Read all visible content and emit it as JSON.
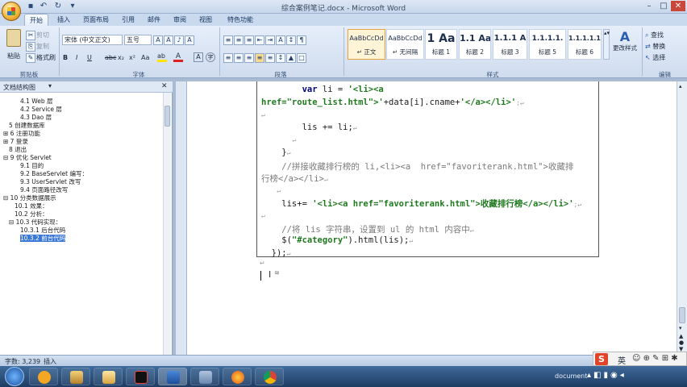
{
  "window": {
    "title": "综合案例笔记.docx - Microsoft Word"
  },
  "tabs": [
    "开始",
    "插入",
    "页面布局",
    "引用",
    "邮件",
    "审阅",
    "视图",
    "特色功能"
  ],
  "clipboard": {
    "paste": "粘贴",
    "cut": "剪切",
    "copy": "复制",
    "format_painter": "格式刷",
    "label": "剪贴板"
  },
  "font": {
    "name": "宋体 (中文正文)",
    "size": "五号",
    "bold": "B",
    "italic": "I",
    "underline": "U",
    "strike": "abc",
    "sub": "x₂",
    "sup": "x²",
    "case": "Aa",
    "label": "字体"
  },
  "paragraph": {
    "label": "段落"
  },
  "styles": {
    "items": [
      {
        "sample": "AaBbCcDd",
        "name": "↵ 正文"
      },
      {
        "sample": "AaBbCcDd",
        "name": "↵ 无间隔"
      },
      {
        "sample": "1 Aa",
        "name": "标题 1"
      },
      {
        "sample": "1.1 Aa",
        "name": "标题 2"
      },
      {
        "sample": "1.1.1 A",
        "name": "标题 3"
      },
      {
        "sample": "1.1.1.1.",
        "name": "标题 5"
      },
      {
        "sample": "1.1.1.1.1",
        "name": "标题 6"
      }
    ],
    "change": "更改样式",
    "label": "样式"
  },
  "editing": {
    "find": "查找",
    "replace": "替换",
    "select": "选择",
    "label": "编辑"
  },
  "left_pane": {
    "title": "文档结构图",
    "items": [
      {
        "text": "4.1 Web 层",
        "indent": 3
      },
      {
        "text": "4.2 Service 层",
        "indent": 3
      },
      {
        "text": "4.3 Dao 层",
        "indent": 3
      },
      {
        "text": "5 创建数据库",
        "indent": 1
      },
      {
        "text": "⊞ 6 注册功能",
        "indent": 0
      },
      {
        "text": "⊞ 7 登录",
        "indent": 0
      },
      {
        "text": "8 退出",
        "indent": 1
      },
      {
        "text": "⊟ 9 优化 Servlet",
        "indent": 0
      },
      {
        "text": "9.1 目的",
        "indent": 3
      },
      {
        "text": "9.2 BaseServlet 编写：",
        "indent": 3
      },
      {
        "text": "9.3 UserServlet 改写",
        "indent": 3
      },
      {
        "text": "9.4 页面路径改写",
        "indent": 3
      },
      {
        "text": "⊟ 10 分类数据展示",
        "indent": 0
      },
      {
        "text": "10.1 效果：",
        "indent": 2
      },
      {
        "text": "10.2   分析：",
        "indent": 2
      },
      {
        "text": "⊟ 10.3 代码实现：",
        "indent": 1
      },
      {
        "text": "10.3.1 后台代码",
        "indent": 3
      },
      {
        "text": "10.3.2 前台代码",
        "indent": 3,
        "selected": true
      }
    ]
  },
  "code": [
    {
      "segs": [
        [
          "        ",
          ""
        ],
        [
          "var",
          ""
        ],
        [
          " li = ",
          ""
        ],
        [
          "'<li><a",
          "st"
        ]
      ]
    },
    {
      "segs": [
        [
          "href=\"route_list.html\">'",
          "st"
        ],
        [
          "+data[i].cname+",
          ""
        ],
        [
          "'</a></li>'",
          "st"
        ],
        [
          ";↵",
          "pm"
        ]
      ]
    },
    {
      "segs": [
        [
          "↵",
          "pm"
        ]
      ]
    },
    {
      "segs": [
        [
          "        lis += li;",
          ""
        ],
        [
          "↵",
          "pm"
        ]
      ]
    },
    {
      "segs": [
        [
          "        ↵",
          "pm"
        ]
      ]
    },
    {
      "segs": [
        [
          "    }",
          ""
        ],
        [
          "↵",
          "pm"
        ]
      ]
    },
    {
      "segs": [
        [
          "    //拼接收藏排行榜的 li,<li><a  href=\"favoriterank.html\">收藏排",
          "cm"
        ]
      ]
    },
    {
      "segs": [
        [
          "行榜</a></li>",
          "cm"
        ],
        [
          "↵",
          "pm"
        ]
      ]
    },
    {
      "segs": [
        [
          "    ↵",
          "pm"
        ]
      ]
    },
    {
      "segs": [
        [
          "    lis+= ",
          ""
        ],
        [
          "'<li><a href=\"favoriterank.html\">收藏排行榜</a></li>'",
          "st"
        ],
        [
          ";↵",
          "pm"
        ]
      ]
    },
    {
      "segs": [
        [
          "↵",
          "pm"
        ]
      ]
    },
    {
      "segs": [
        [
          "    //将 lis 字符串，设置到 ul 的 html 内容中",
          "cm"
        ],
        [
          "↵",
          "pm"
        ]
      ]
    },
    {
      "segs": [
        [
          "    $(",
          ""
        ],
        [
          "\"#category\"",
          "st"
        ],
        [
          ").html(lis);",
          ""
        ],
        [
          "↵",
          "pm"
        ]
      ]
    },
    {
      "segs": [
        [
          "  });",
          ""
        ],
        [
          "↵",
          "pm"
        ]
      ]
    }
  ],
  "status": {
    "words": "字数: 3,239",
    "mode": "插入"
  },
  "taskbar": {
    "tray_text": "document"
  },
  "ime": {
    "lang": "英"
  }
}
